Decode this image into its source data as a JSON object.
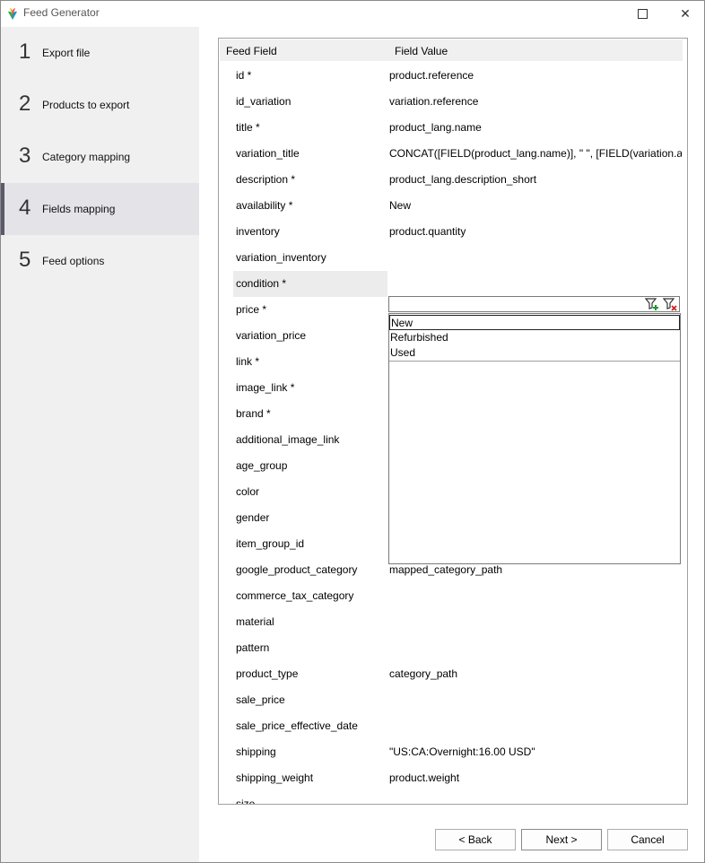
{
  "window": {
    "title": "Feed Generator"
  },
  "sidebar": {
    "steps": [
      {
        "number": "1",
        "label": "Export file"
      },
      {
        "number": "2",
        "label": "Products to export"
      },
      {
        "number": "3",
        "label": "Category mapping"
      },
      {
        "number": "4",
        "label": "Fields mapping"
      },
      {
        "number": "5",
        "label": "Feed options"
      }
    ],
    "active_step": "Fields mapping"
  },
  "grid": {
    "headers": {
      "field": "Feed Field",
      "value": "Field Value"
    },
    "rows": [
      {
        "field": "id *",
        "value": "product.reference"
      },
      {
        "field": "id_variation",
        "value": "variation.reference"
      },
      {
        "field": "title *",
        "value": "product_lang.name"
      },
      {
        "field": "variation_title",
        "value": "CONCAT([FIELD(product_lang.name)], \" \", [FIELD(variation.attribu"
      },
      {
        "field": "description *",
        "value": "product_lang.description_short"
      },
      {
        "field": "availability *",
        "value": "New"
      },
      {
        "field": "inventory",
        "value": "product.quantity"
      },
      {
        "field": "variation_inventory",
        "value": ""
      },
      {
        "field": "condition *",
        "value": ""
      },
      {
        "field": "price *",
        "value": ""
      },
      {
        "field": "variation_price",
        "value": ""
      },
      {
        "field": "link *",
        "value": ""
      },
      {
        "field": "image_link *",
        "value": ""
      },
      {
        "field": "brand *",
        "value": ""
      },
      {
        "field": "additional_image_link",
        "value": ""
      },
      {
        "field": "age_group",
        "value": ""
      },
      {
        "field": "color",
        "value": ""
      },
      {
        "field": "gender",
        "value": ""
      },
      {
        "field": "item_group_id",
        "value": ""
      },
      {
        "field": "google_product_category",
        "value": "mapped_category_path"
      },
      {
        "field": "commerce_tax_category",
        "value": ""
      },
      {
        "field": "material",
        "value": ""
      },
      {
        "field": "pattern",
        "value": ""
      },
      {
        "field": "product_type",
        "value": "category_path"
      },
      {
        "field": "sale_price",
        "value": ""
      },
      {
        "field": "sale_price_effective_date",
        "value": ""
      },
      {
        "field": "shipping",
        "value": "\"US:CA:Overnight:16.00 USD\""
      },
      {
        "field": "shipping_weight",
        "value": "product.weight"
      },
      {
        "field": "size",
        "value": ""
      }
    ],
    "selected_field": "condition *"
  },
  "dropdown": {
    "input_value": "",
    "options": [
      "New",
      "Refurbished",
      "Used"
    ],
    "highlighted": "New",
    "icons": [
      "filter-add-icon",
      "filter-clear-icon"
    ]
  },
  "buttons": {
    "back": "< Back",
    "next": "Next >",
    "cancel": "Cancel"
  },
  "colors": {
    "sidebar_bg": "#f0f0f0",
    "active_step_bg": "#e3e3e8",
    "selected_row_bg": "#ececec"
  }
}
